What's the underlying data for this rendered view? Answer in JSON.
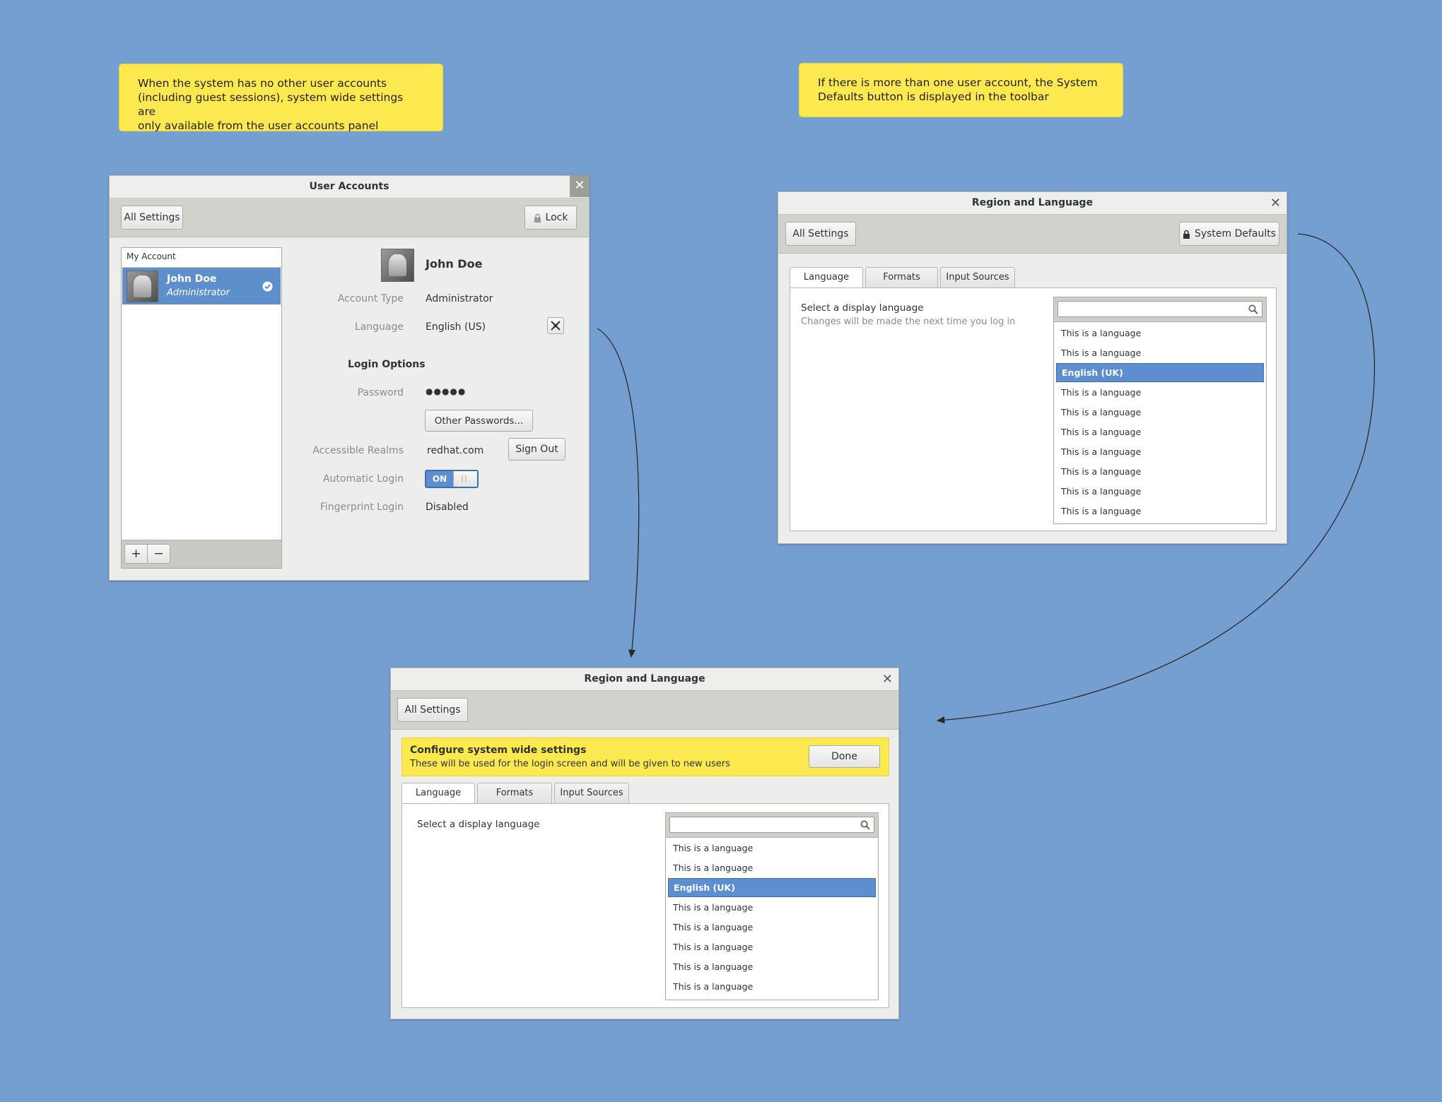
{
  "notes": {
    "left": "When the system has no other user accounts\n(including guest sessions), system wide settings are\nonly available from the user accounts panel",
    "right": "If there is more than one user account, the System\nDefaults button is displayed in the toolbar"
  },
  "user_accounts": {
    "title": "User Accounts",
    "all_settings": "All Settings",
    "lock": "Lock",
    "sidebar_header": "My Account",
    "user_name": "John Doe",
    "user_role": "Administrator",
    "display_name": "John Doe",
    "account_type_label": "Account Type",
    "account_type_value": "Administrator",
    "language_label": "Language",
    "language_value": "English (US)",
    "login_options": "Login Options",
    "password_label": "Password",
    "password_value": "●●●●●",
    "other_passwords": "Other Passwords...",
    "realms_label": "Accessible Realms",
    "realms_value": "redhat.com",
    "sign_out": "Sign Out",
    "auto_login_label": "Automatic Login",
    "auto_login_state": "ON",
    "fingerprint_label": "Fingerprint Login",
    "fingerprint_value": "Disabled",
    "add": "+",
    "remove": "−"
  },
  "region_top": {
    "title": "Region and Language",
    "all_settings": "All Settings",
    "system_defaults": "System Defaults",
    "tabs": [
      "Language",
      "Formats",
      "Input Sources"
    ],
    "select_label": "Select a display language",
    "hint": "Changes will be made the next time you log in",
    "languages": [
      "This is a language",
      "This is a language",
      "English (UK)",
      "This is a language",
      "This is a language",
      "This is a language",
      "This is a language",
      "This is a language",
      "This is a language",
      "This is a language"
    ],
    "selected_index": 2
  },
  "region_bottom": {
    "title": "Region and Language",
    "all_settings": "All Settings",
    "banner_title": "Configure system wide settings",
    "banner_text": "These will be used for the login screen and will be given to new users",
    "done": "Done",
    "tabs": [
      "Language",
      "Formats",
      "Input Sources"
    ],
    "select_label": "Select a display language",
    "languages": [
      "This is a language",
      "This is a language",
      "English (UK)",
      "This is a language",
      "This is a language",
      "This is a language",
      "This is a language",
      "This is a language"
    ],
    "selected_index": 2
  },
  "colors": {
    "background": "#769fd1",
    "note": "#fce94f",
    "selection": "#5c8ed0"
  }
}
